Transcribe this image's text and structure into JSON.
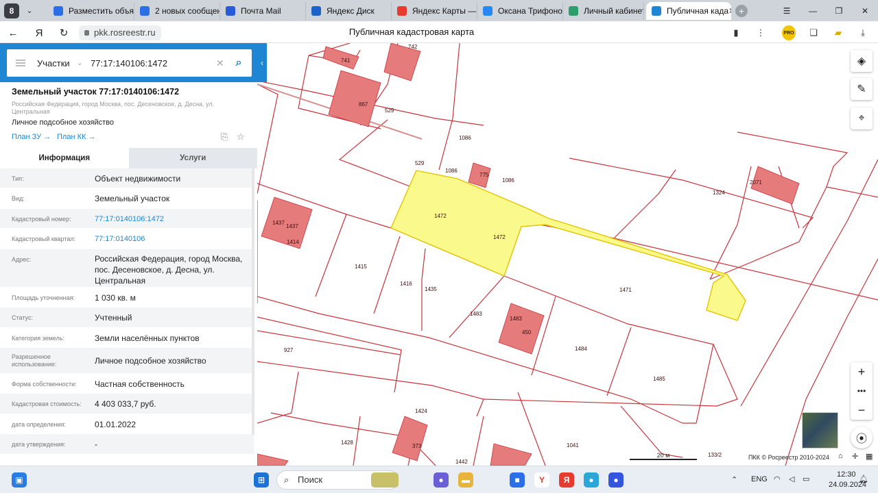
{
  "browser": {
    "tabs": [
      {
        "label": "Разместить объя",
        "color": "#2a6ee8"
      },
      {
        "label": "2 новых сообщен",
        "color": "#2a6ee8"
      },
      {
        "label": "Почта Mail",
        "color": "#2a5bd7"
      },
      {
        "label": "Яндекс Диск",
        "color": "#1b62c9"
      },
      {
        "label": "Яндекс Карты —",
        "color": "#e83a2f"
      },
      {
        "label": "Оксана Трифонов",
        "color": "#2787f5"
      },
      {
        "label": "Личный кабинет",
        "color": "#2a9e6b"
      },
      {
        "label": "Публичная када",
        "color": "#1e86d2"
      }
    ],
    "url": "pkk.rosreestr.ru",
    "page_title": "Публичная кадастровая карта",
    "ya_badge": "8",
    "pro_badge": "PRO"
  },
  "search": {
    "type": "Участки",
    "value": "77:17:140106:1472"
  },
  "object": {
    "title": "Земельный участок 77:17:0140106:1472",
    "address": "Российская Федерация, город Москва, пос. Десеновское, д. Десна, ул. Центральная",
    "use": "Личное подсобное хозяйство",
    "plan_zu": "План ЗУ",
    "plan_kk": "План КК"
  },
  "info_tabs": {
    "info": "Информация",
    "services": "Услуги"
  },
  "rows": [
    {
      "k": "Тип:",
      "v": "Объект недвижимости"
    },
    {
      "k": "Вид:",
      "v": "Земельный участок"
    },
    {
      "k": "Кадастровый номер:",
      "v": "77:17:0140106:1472"
    },
    {
      "k": "Кадастровый квартал:",
      "v": "77:17:0140106"
    },
    {
      "k": "Адрес:",
      "v": "Российская Федерация, город Москва, пос. Десеновское, д. Десна, ул. Центральная"
    },
    {
      "k": "Площадь уточненная:",
      "v": "1 030 кв. м"
    },
    {
      "k": "Статус:",
      "v": "Учтенный"
    },
    {
      "k": "Категория земель:",
      "v": "Земли населённых пунктов"
    },
    {
      "k": "Разрешенное использование:",
      "v": "Личное подсобное хозяйство"
    },
    {
      "k": "Форма собственности:",
      "v": "Частная собственность"
    },
    {
      "k": "Кадастровая стоимость:",
      "v": "4 403 033,7 руб."
    },
    {
      "k": "дата определения:",
      "v": "01.01.2022"
    },
    {
      "k": "дата утверждения:",
      "v": "-"
    }
  ],
  "map": {
    "labels": {
      "l741": "741",
      "l742": "742",
      "l867": "867",
      "l529a": "529",
      "l529b": "529",
      "l1086a": "1086",
      "l1086b": "1086",
      "l1086c": "1086",
      "l775": "775",
      "l2071": "2071",
      "l1324": "1324",
      "l1472a": "1472",
      "l1472b": "1472",
      "l1437a": "1437",
      "l1437b": "1437",
      "l1414": "1414",
      "l1415": "1415",
      "l1416": "1416",
      "l1435": "1435",
      "l1471": "1471",
      "l1483a": "1483",
      "l1483b": "1483",
      "l450": "450",
      "l927": "927",
      "l1484": "1484",
      "l1485": "1485",
      "l1424": "1424",
      "l1428": "1428",
      "l373": "373",
      "l1041": "1041",
      "l1442": "1442",
      "l133": "133/2"
    },
    "scale": "20 м",
    "copyright": "ПКК © Росреестр 2010-2024"
  },
  "taskbar": {
    "search": "Поиск",
    "lang": "ENG",
    "time": "12:30",
    "date": "24.09.2024"
  }
}
